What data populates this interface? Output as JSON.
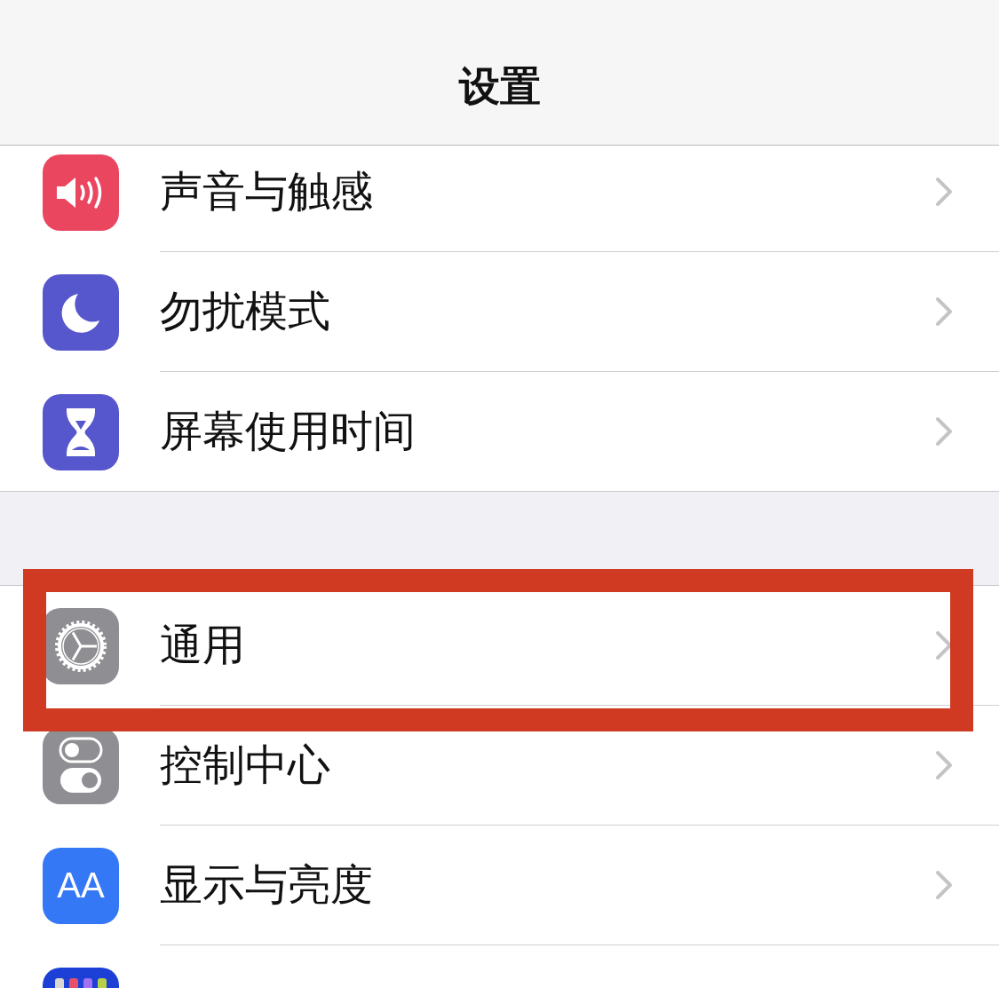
{
  "nav_bar": {
    "title": "设置"
  },
  "groups": [
    {
      "rows": [
        {
          "label": "声音与触感",
          "color": "#ea4660",
          "highlighted": false
        },
        {
          "label": "勿扰模式",
          "color": "#5757cd",
          "highlighted": false
        },
        {
          "label": "屏幕使用时间",
          "color": "#5757cd",
          "highlighted": false
        }
      ]
    },
    {
      "rows": [
        {
          "label": "通用",
          "color": "#8e8e93",
          "highlighted": true
        },
        {
          "label": "控制中心",
          "color": "#8e8e93",
          "highlighted": false
        },
        {
          "label": "显示与亮度",
          "color": "#3478f6",
          "icon_label": "AA",
          "highlighted": false
        },
        {
          "color": "#1c3fd6",
          "highlighted": false
        }
      ]
    }
  ]
}
